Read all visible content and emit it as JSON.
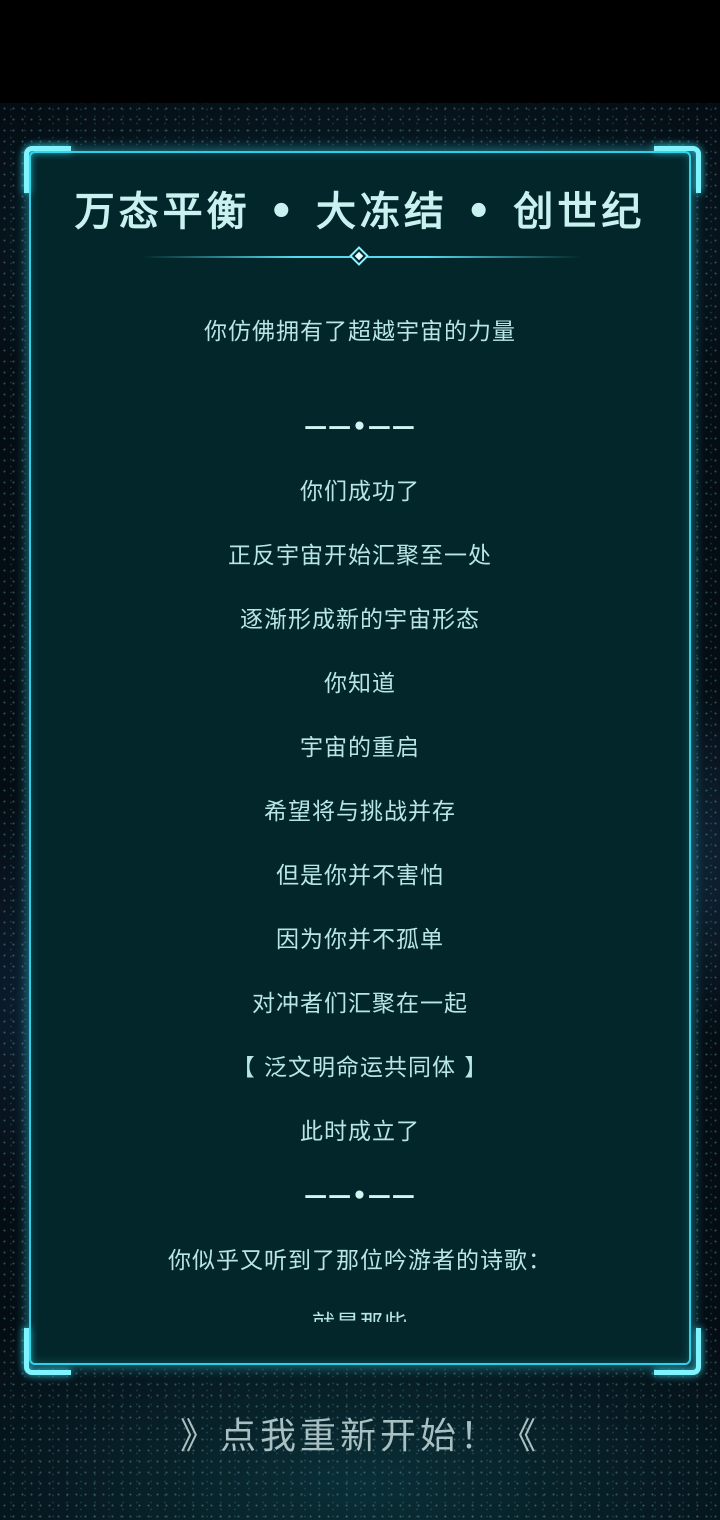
{
  "panel": {
    "title": "万态平衡 • 大冻结 • 创世纪",
    "lines": [
      "你仿佛拥有了超越宇宙的力量",
      "——•——",
      "你们成功了",
      "正反宇宙开始汇聚至一处",
      "逐渐形成新的宇宙形态",
      "你知道",
      "宇宙的重启",
      "希望将与挑战并存",
      "但是你并不害怕",
      "因为你并不孤单",
      "对冲者们汇聚在一起",
      "【 泛文明命运共同体 】",
      "此时成立了",
      "——•——",
      "你似乎又听到了那位吟游者的诗歌：",
      "就是那些"
    ]
  },
  "restart_button": {
    "label": "》点我重新开始！《"
  },
  "colors": {
    "accent": "#2fd0e6",
    "panel_bg": "#03262a",
    "text": "#b8e6e4"
  }
}
